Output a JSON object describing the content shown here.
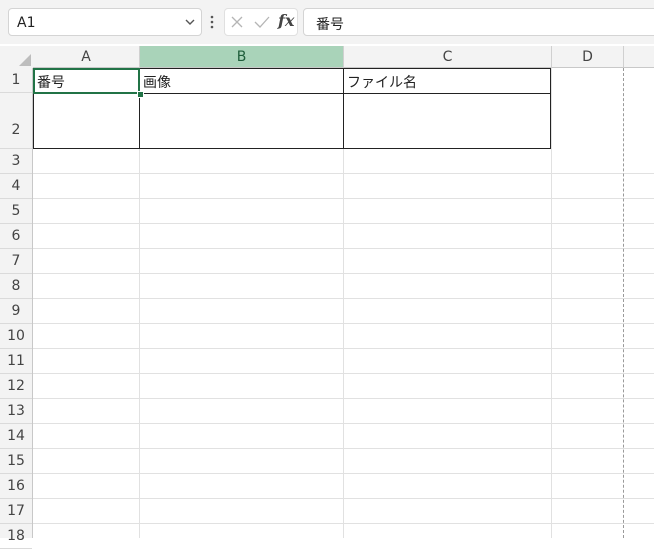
{
  "formula_bar": {
    "name_box": "A1",
    "fx_label": "fx",
    "formula_value": "番号"
  },
  "columns": [
    "A",
    "B",
    "C",
    "D"
  ],
  "selected_column": "B",
  "rows": [
    "1",
    "2",
    "3",
    "4",
    "5",
    "6",
    "7",
    "8",
    "9",
    "10",
    "11",
    "12",
    "13",
    "14",
    "15",
    "16",
    "17",
    "18"
  ],
  "cells": {
    "A1": "番号",
    "B1": "画像",
    "C1": "ファイル名"
  },
  "colors": {
    "accent": "#217346",
    "selected_header": "#a9d3b9"
  }
}
